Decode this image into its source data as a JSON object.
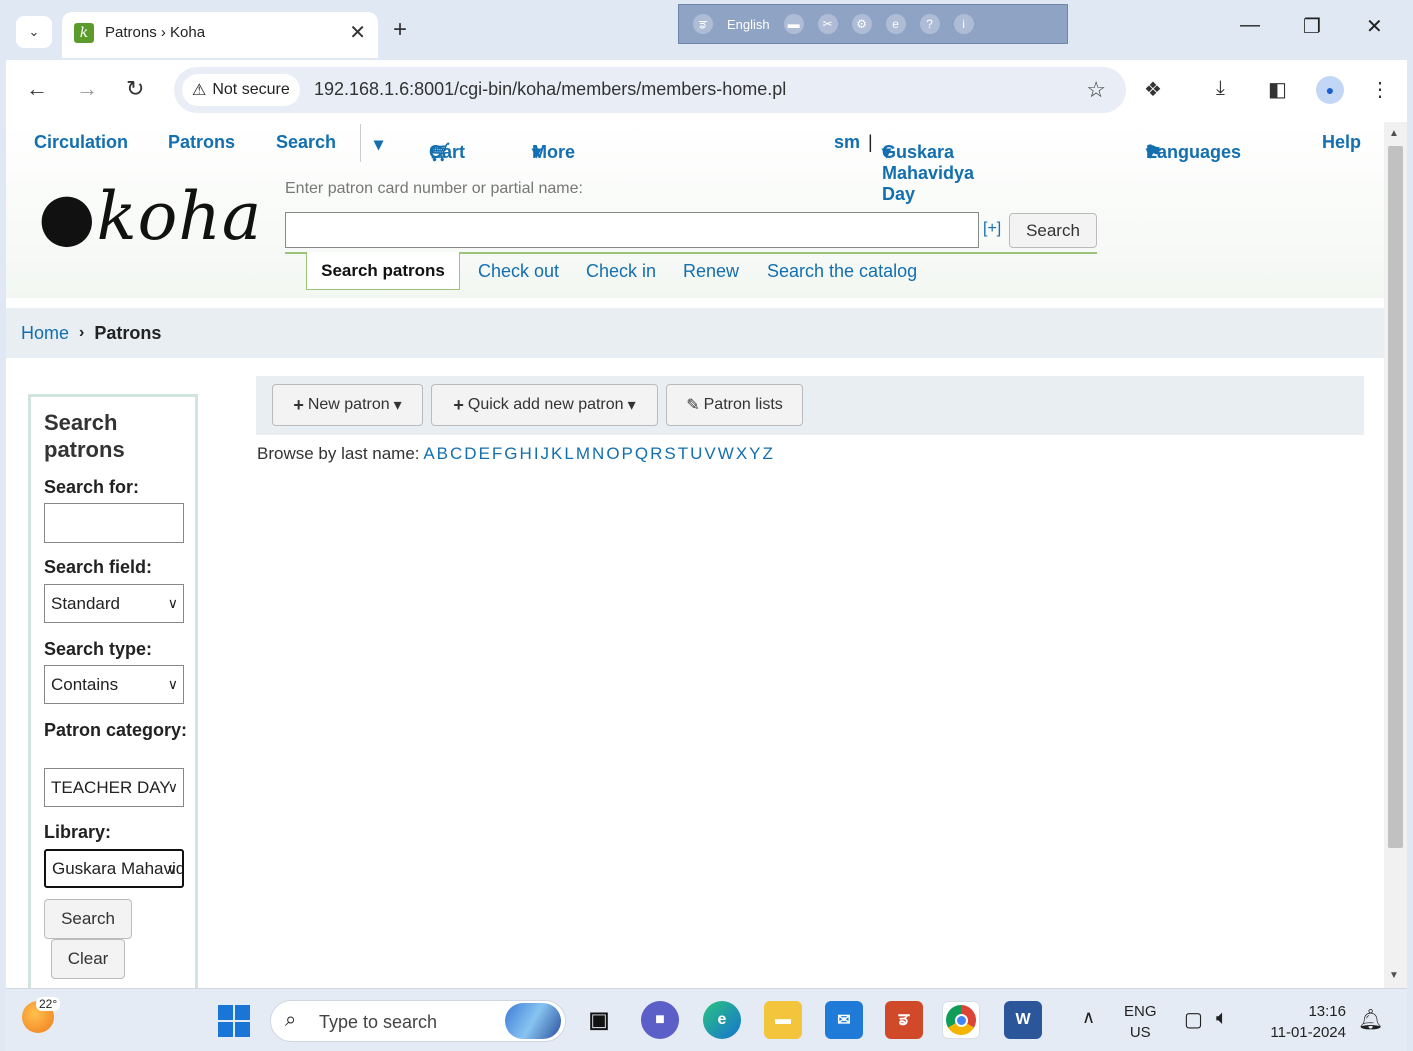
{
  "browser": {
    "tab_title": "Patrons › Koha",
    "tab_favicon_letter": "k",
    "lang_bar_label": "English",
    "not_secure_label": "Not secure",
    "url": "192.168.1.6:8001/cgi-bin/koha/members/members-home.pl"
  },
  "topnav": {
    "circulation": "Circulation",
    "patrons": "Patrons",
    "search": "Search",
    "cart": "Cart",
    "more": "More",
    "user": "sm",
    "separator": "|",
    "library": "Guskara Mahavidya Day",
    "languages": "Languages",
    "help": "Help"
  },
  "header": {
    "logo_text": "koha",
    "patron_prompt": "Enter patron card number or partial name:",
    "patron_input_value": "",
    "plus_link": "[+]",
    "search_button": "Search",
    "tabs": {
      "search_patrons": "Search patrons",
      "check_out": "Check out",
      "check_in": "Check in",
      "renew": "Renew",
      "search_catalog": "Search the catalog"
    }
  },
  "breadcrumb": {
    "home": "Home",
    "current": "Patrons"
  },
  "sidebar": {
    "title": "Search patrons",
    "search_for_label": "Search for:",
    "search_for_value": "",
    "search_field_label": "Search field:",
    "search_field_value": "Standard",
    "search_type_label": "Search type:",
    "search_type_value": "Contains",
    "patron_category_label": "Patron category:",
    "patron_category_value": "TEACHER DAY",
    "library_label": "Library:",
    "library_value": "Guskara Mahavidya Day",
    "search_button": "Search",
    "clear_button": "Clear"
  },
  "toolbar": {
    "new_patron": "New patron",
    "quick_add": "Quick add new patron",
    "patron_lists": "Patron lists"
  },
  "browse": {
    "label": "Browse by last name:",
    "letters": [
      "A",
      "B",
      "C",
      "D",
      "E",
      "F",
      "G",
      "H",
      "I",
      "J",
      "K",
      "L",
      "M",
      "N",
      "O",
      "P",
      "Q",
      "R",
      "S",
      "T",
      "U",
      "V",
      "W",
      "X",
      "Y",
      "Z"
    ]
  },
  "taskbar": {
    "temperature": "22°",
    "search_placeholder": "Type to search",
    "lang_line1": "ENG",
    "lang_line2": "US",
    "time": "13:16",
    "date": "11-01-2024"
  },
  "colors": {
    "link": "#136fb0",
    "tab_rule": "#9ac47a",
    "breadcrumb_bg": "#e8eef1"
  }
}
